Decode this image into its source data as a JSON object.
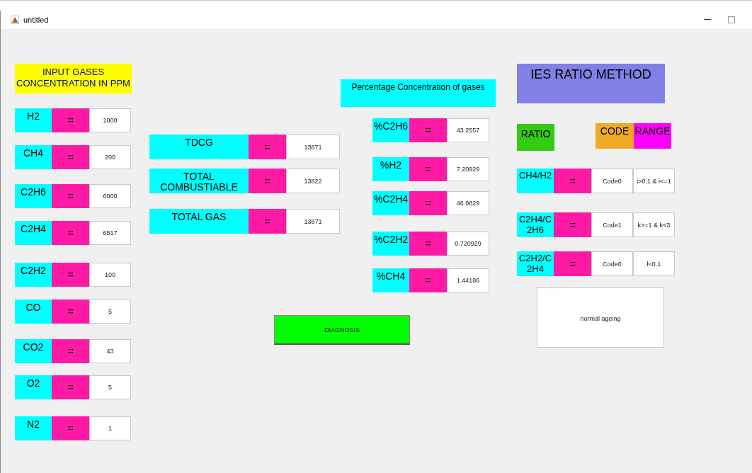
{
  "window": {
    "title": "untitled"
  },
  "input_panel": {
    "heading": "INPUT GASES CONCENTRATION IN PPM",
    "rows": [
      {
        "label": "H2",
        "sign": "=",
        "value": "1000"
      },
      {
        "label": "CH4",
        "sign": "=",
        "value": "200"
      },
      {
        "label": "C2H6",
        "sign": "=",
        "value": "6000"
      },
      {
        "label": "C2H4",
        "sign": "=",
        "value": "6517"
      },
      {
        "label": "C2H2",
        "sign": "=",
        "value": "100"
      },
      {
        "label": "CO",
        "sign": "=",
        "value": "5"
      },
      {
        "label": "CO2",
        "sign": "=",
        "value": "43"
      },
      {
        "label": "O2",
        "sign": "=",
        "value": "5"
      },
      {
        "label": "N2",
        "sign": "=",
        "value": "1"
      }
    ]
  },
  "totals": {
    "rows": [
      {
        "label": "TDCG",
        "sign": "=",
        "value": "13871"
      },
      {
        "label": "TOTAL COMBUSTIABLE",
        "sign": "=",
        "value": "13822"
      },
      {
        "label": "TOTAL GAS",
        "sign": "=",
        "value": "13871"
      }
    ],
    "diagnosis_button": "DIAGNOSIS"
  },
  "percentage": {
    "heading": "Percentage Concentration of gases",
    "rows": [
      {
        "label": "%C2H6",
        "sign": "=",
        "value": "43.2557"
      },
      {
        "label": "%H2",
        "sign": "=",
        "value": "7.20929"
      },
      {
        "label": "%C2H4",
        "sign": "=",
        "value": "46.9829"
      },
      {
        "label": "%C2H2",
        "sign": "=",
        "value": "0.720929"
      },
      {
        "label": "%CH4",
        "sign": "=",
        "value": "1.44186"
      }
    ]
  },
  "ies": {
    "title": "IES RATIO METHOD",
    "ratio_heading": "RATIO",
    "code_heading": "CODE",
    "range_heading": "RANGE",
    "rows": [
      {
        "label": "CH4/H2",
        "sign": "=",
        "code": "Code0",
        "range": "i>0.1 & i<=1"
      },
      {
        "label": "C2H4/C2H6",
        "sign": "=",
        "code": "Code1",
        "range": "k>=1 & k<3"
      },
      {
        "label": "C2H2/C2H4",
        "sign": "=",
        "code": "Code0",
        "range": "l<0.1"
      }
    ],
    "result": "normal ageing"
  }
}
